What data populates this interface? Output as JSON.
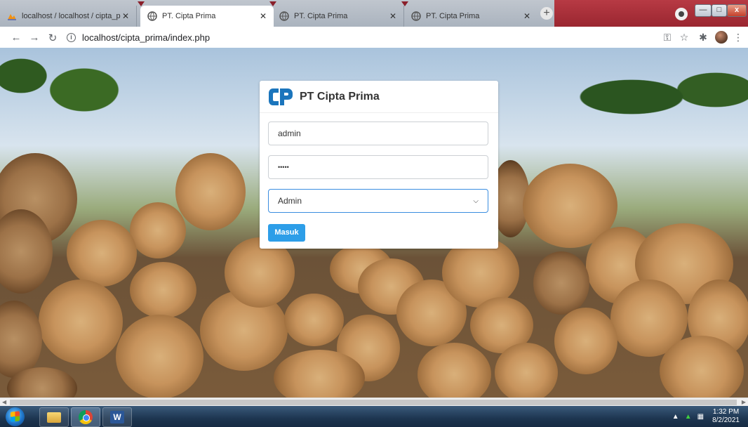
{
  "browser": {
    "tabs": [
      {
        "title": "localhost / localhost / cipta_prim",
        "icon": "phpmyadmin-icon",
        "active": false
      },
      {
        "title": "PT. Cipta Prima",
        "icon": "globe-icon",
        "active": true
      },
      {
        "title": "PT. Cipta Prima",
        "icon": "globe-icon",
        "active": false
      },
      {
        "title": "PT. Cipta Prima",
        "icon": "globe-icon",
        "active": false
      }
    ],
    "new_tab_label": "+",
    "url": "localhost/cipta_prima/index.php",
    "window_controls": {
      "minimize": "—",
      "maximize": "□",
      "close": "x"
    }
  },
  "login": {
    "brand": "PT Cipta Prima",
    "username_value": "admin",
    "password_value": "•••••",
    "role_selected": "Admin",
    "submit_label": "Masuk"
  },
  "taskbar": {
    "time": "1:32 PM",
    "date": "8/2/2021",
    "word_label": "W"
  },
  "colors": {
    "primary_button": "#2d9ee8",
    "select_focus": "#3a8de0",
    "logo_blue": "#1b75bc"
  }
}
